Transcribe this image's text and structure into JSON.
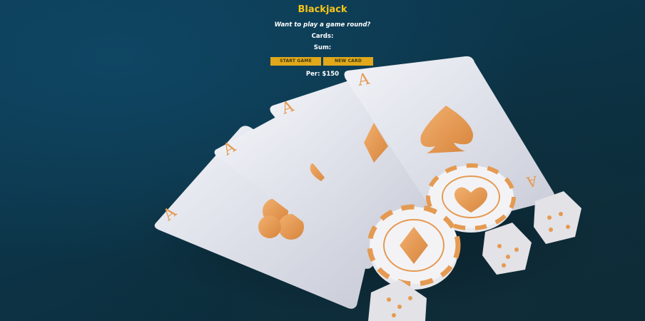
{
  "game": {
    "title": "Blackjack",
    "message": "Want to play a game round?",
    "cards_label": "Cards:",
    "sum_label": "Sum:",
    "start_button": "START GAME",
    "new_card_button": "NEW CARD",
    "player_info": "Per: $150"
  },
  "theme": {
    "background": "#0c3447",
    "title_color": "#f5c518",
    "button_color": "#e0a81a",
    "button_text_color": "#3d3a14",
    "text_color": "#ffffff",
    "card_color": "#e6e8f0",
    "accent_orange": "#e59a52"
  },
  "background_art": {
    "description_icons": [
      "playing-cards-icon",
      "poker-chips-icon",
      "dice-icon"
    ],
    "card_ranks": [
      "A",
      "A",
      "A",
      "A"
    ]
  }
}
